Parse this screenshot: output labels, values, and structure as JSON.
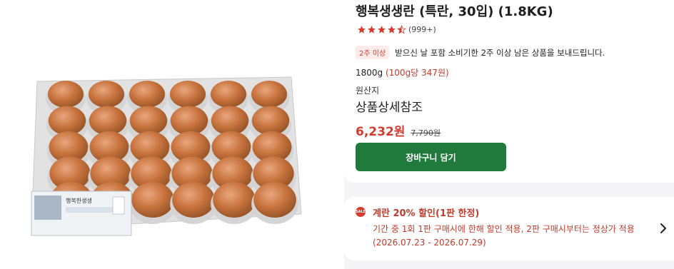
{
  "product": {
    "title": "행복생생란 (특란, 30입) (1.8KG)",
    "rating": {
      "stars": 4.5,
      "count": "(999+)"
    },
    "freshness_badge": "2주 이상",
    "freshness_text": "받으신 날 포함 소비기한 2주 이상 남은 상품을 보내드립니다.",
    "weight": "1800g",
    "unit_price": "(100g당 347원)",
    "origin_label": "원산지",
    "origin_value": "상품상세참조",
    "sale_price": "6,232원",
    "original_price": "7,790원",
    "cart_button": "장바구니 담기"
  },
  "image": {
    "package_label": "행복한생생",
    "eggs_rows": 5,
    "eggs_cols": 6
  },
  "promo": {
    "icon_text": "SALE",
    "title": "계란 20% 할인(1판 한정)",
    "description": "기간 중 1회 1판 구매시에 한해 할인 적용, 2판 구매시부터는 정상가 적용(2026.07.23 - 2026.07.29)"
  },
  "colors": {
    "accent_red": "#d63a2f",
    "button_green": "#1f7a3c",
    "star": "#d63a2f"
  },
  "icons": [
    "star-icon",
    "half-star-icon",
    "sale-icon",
    "chevron-right-icon"
  ]
}
